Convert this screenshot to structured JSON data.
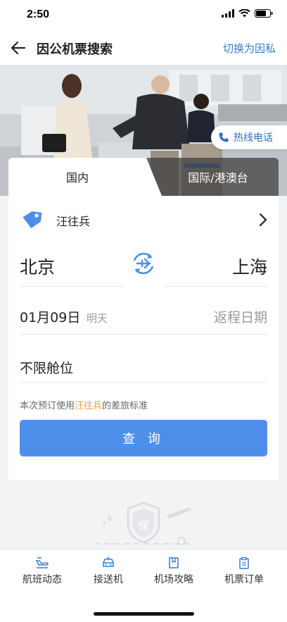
{
  "status_bar": {
    "time": "2:50"
  },
  "nav": {
    "title": "因公机票搜索",
    "switch_label": "切换为因私"
  },
  "hero": {
    "hotline_label": "热线电话"
  },
  "tabs": {
    "domestic": "国内",
    "international": "国际/港澳台",
    "active": "domestic"
  },
  "traveler": {
    "name": "汪往兵"
  },
  "route": {
    "from": "北京",
    "to": "上海"
  },
  "date": {
    "depart": "01月09日",
    "depart_note": "明天",
    "return_placeholder": "返程日期"
  },
  "cabin": {
    "label": "不限舱位"
  },
  "policy": {
    "prefix": "本次预订使用",
    "name": "汪往兵",
    "suffix": "的差旅标准"
  },
  "search_button": {
    "label": "查 询"
  },
  "bottom_tabs": [
    {
      "label": "航班动态",
      "icon": "flight-status-icon"
    },
    {
      "label": "接送机",
      "icon": "car-icon"
    },
    {
      "label": "机场攻略",
      "icon": "book-icon"
    },
    {
      "label": "机票订单",
      "icon": "clipboard-icon"
    }
  ],
  "colors": {
    "accent": "#4e8fec",
    "link": "#3d7ccc",
    "highlight": "#e3a23a"
  }
}
